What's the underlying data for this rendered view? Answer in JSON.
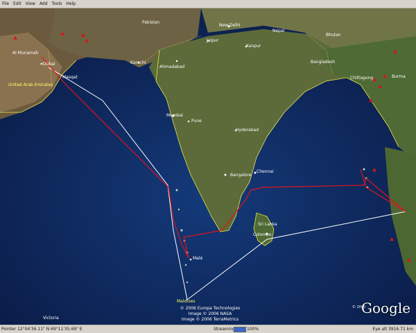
{
  "menu": [
    "File",
    "Edit",
    "View",
    "Add",
    "Tools",
    "Help"
  ],
  "places": {
    "pakistan": "Pakistan",
    "new_delhi": "New Delhi",
    "nepal": "Nepal",
    "bhutan": "Bhutan",
    "jaipur": "Jaipur",
    "kanpur": "Kanpur",
    "karachi": "Karachi",
    "ahmadabad": "Ahmadabad",
    "bangladesh": "Bangladesh",
    "al_munamah": "Al Munamah",
    "dubai": "Dubai",
    "masqat": "Masqat",
    "uae": "United Arab Emirates",
    "mumbai": "Mumbai",
    "pune": "Pune",
    "hyderabad": "Hyderabad",
    "bangalore": "Bangalore",
    "chennai": "Chennai",
    "sri_lanka": "Sri Lanka",
    "colombo": "Colombo",
    "male": "Malé",
    "maldives": "Maldives",
    "chittagong": "Chittagong",
    "burma": "Burma",
    "victoria": "Victoria"
  },
  "credits": [
    "© 2006 Europa Technologies",
    "Image © 2006 NASA",
    "Image © 2006 TerraMetrics"
  ],
  "branding": {
    "logo": "Google",
    "copyright": "© 2005"
  },
  "status": {
    "pointer": "Pointer 12°04'36.11\" N   69°11'35.69\" E",
    "streaming_label": "Streaming",
    "streaming_percent": "100%",
    "streaming_fraction": 1.0,
    "eye_alt": "Eye alt 3916.71 km"
  },
  "colors": {
    "ocean": "#0c1f4a",
    "route_red": "#e0141c",
    "route_white": "#ffffff",
    "border_yellow": "#e8e84a"
  }
}
